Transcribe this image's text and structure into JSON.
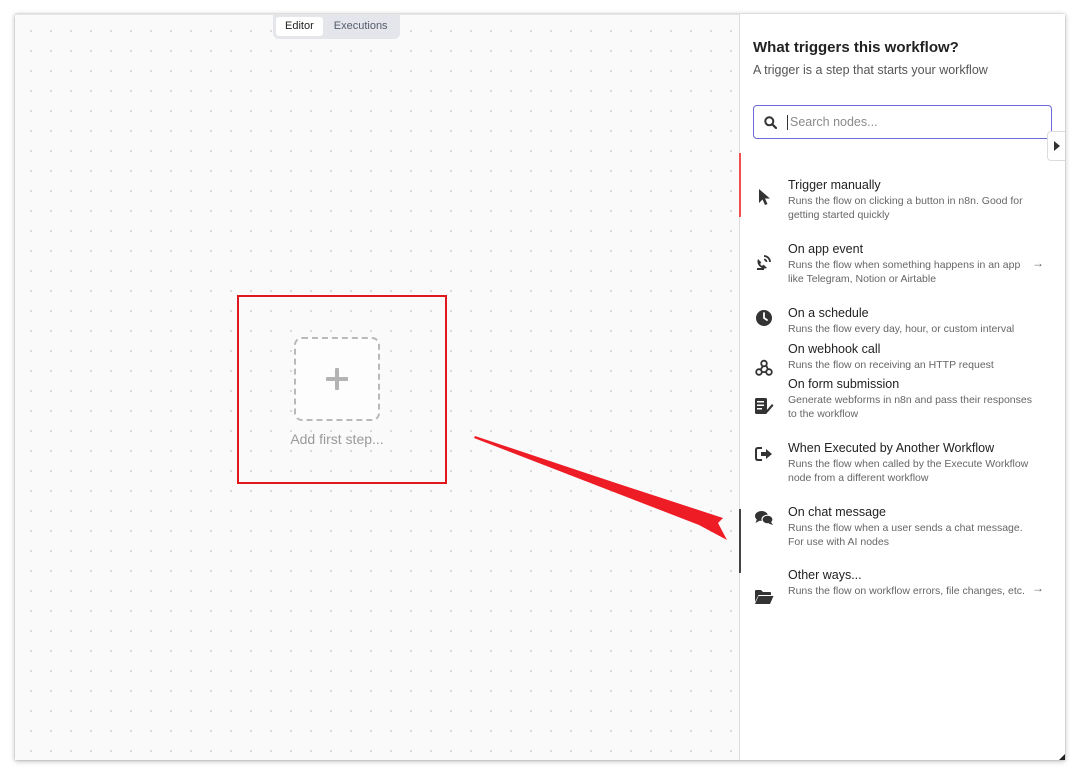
{
  "view_tabs": [
    {
      "label": "Editor",
      "active": true
    },
    {
      "label": "Executions",
      "active": false
    }
  ],
  "canvas": {
    "add_step_label": "Add first step..."
  },
  "panel": {
    "title": "What triggers this workflow?",
    "subtitle": "A trigger is a step that starts your workflow",
    "search": {
      "placeholder": "Search nodes...",
      "value": ""
    },
    "items": [
      {
        "title": "Trigger manually",
        "desc": "Runs the flow on clicking a button in n8n. Good for getting started quickly",
        "icon": "cursor-icon",
        "has_arrow": false
      },
      {
        "title": "On app event",
        "desc": "Runs the flow when something happens in an app like Telegram, Notion or Airtable",
        "icon": "satellite-dish-icon",
        "has_arrow": true,
        "arrow": "→"
      },
      {
        "title": "On a schedule",
        "desc": "Runs the flow every day, hour, or custom interval",
        "icon": "clock-icon",
        "has_arrow": false
      },
      {
        "title": "On webhook call",
        "desc": "Runs the flow on receiving an HTTP request",
        "icon": "webhook-icon",
        "has_arrow": false
      },
      {
        "title": "On form submission",
        "desc": "Generate webforms in n8n and pass their responses to the workflow",
        "icon": "form-icon",
        "has_arrow": false
      },
      {
        "title": "When Executed by Another Workflow",
        "desc": "Runs the flow when called by the Execute Workflow node from a different workflow",
        "icon": "sign-in-icon",
        "has_arrow": false
      },
      {
        "title": "On chat message",
        "desc": "Runs the flow when a user sends a chat message. For use with AI nodes",
        "icon": "chat-icon",
        "has_arrow": false
      },
      {
        "title": "Other ways...",
        "desc": "Runs the flow on workflow errors, file changes, etc.",
        "icon": "folder-open-icon",
        "has_arrow": true,
        "arrow": "→"
      }
    ]
  },
  "colors": {
    "highlight": "#e0181e",
    "search_border": "#6b6bd8",
    "selected_bar": "#ee4f4f"
  }
}
